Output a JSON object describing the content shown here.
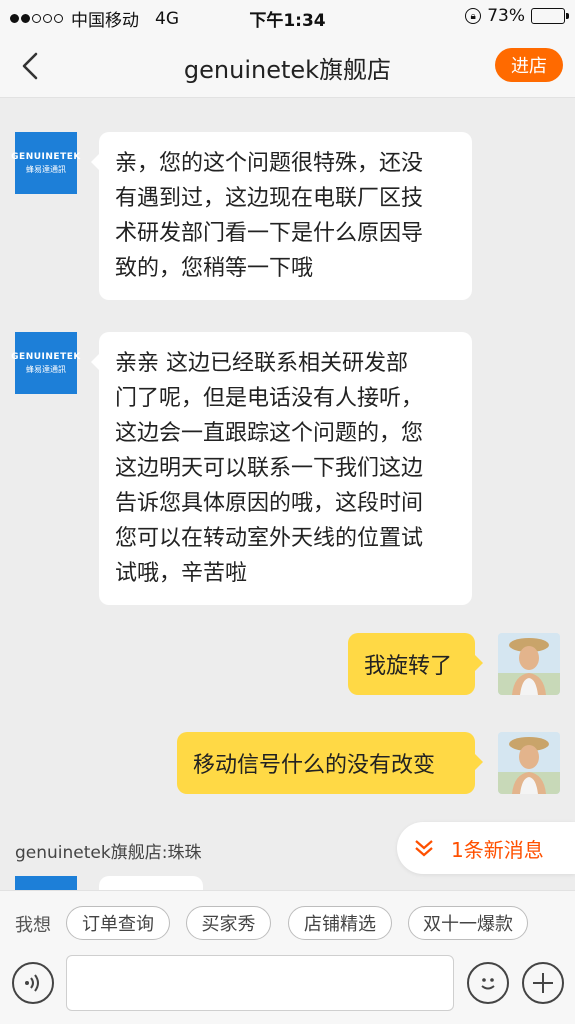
{
  "status_bar": {
    "carrier": "中国移动",
    "network": "4G",
    "time": "下午1:34",
    "battery": "73%",
    "battery_level": 0.73,
    "signal_bars": 2
  },
  "nav": {
    "title": "genuinetek旗舰店",
    "enter_label": "进店"
  },
  "shop_avatar": {
    "line1": "GENUINETEK",
    "line2": "蜂易達通訊"
  },
  "messages": [
    {
      "from": "shop",
      "lines": [
        "亲，您的这个问题很特殊，还没",
        "有遇到过，这边现在电联厂区技",
        "术研发部门看一下是什么原因导",
        "致的，您稍等一下哦"
      ]
    },
    {
      "from": "shop",
      "lines": [
        "亲亲 这边已经联系相关研发部",
        "门了呢，但是电话没有人接听，",
        "这边会一直跟踪这个问题的，您",
        "这边明天可以联系一下我们这边",
        "告诉您具体原因的哦，这段时间",
        "您可以在转动室外天线的位置试",
        "试哦，辛苦啦"
      ]
    },
    {
      "from": "user",
      "text": "我旋转了"
    },
    {
      "from": "user",
      "text": "移动信号什么的没有改变"
    }
  ],
  "sender_name": "genuinetek旗舰店:珠珠",
  "new_message_label": "1条新消息",
  "quick_bar": {
    "label": "我想",
    "chips": [
      "订单查询",
      "买家秀",
      "店铺精选",
      "双十一爆款"
    ]
  },
  "colors": {
    "accent": "#ff6a00",
    "user_bubble": "#ffd945",
    "shop_avatar": "#1d7fd8",
    "new_message": "#ff5000"
  },
  "icons": [
    "voice-icon",
    "emoji-icon",
    "plus-icon",
    "back-icon",
    "chevron-double-down-icon"
  ]
}
